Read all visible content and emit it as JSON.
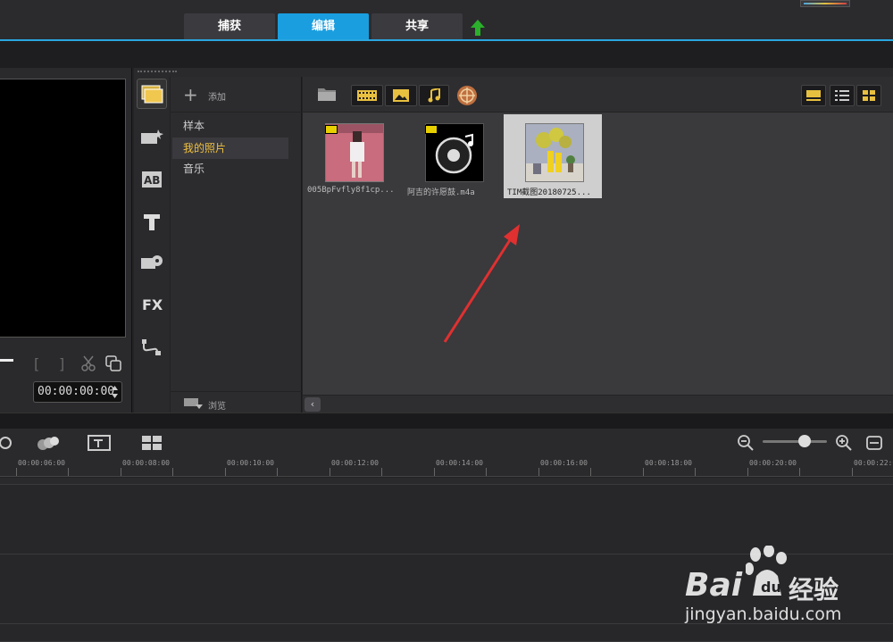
{
  "header": {
    "tabs": [
      {
        "label": "捕获"
      },
      {
        "label": "编辑"
      },
      {
        "label": "共享"
      }
    ],
    "active_tab": "编辑"
  },
  "preview": {
    "timecode": "00:00:00:00"
  },
  "library": {
    "add_label": "添加",
    "folders": [
      {
        "label": "样本"
      },
      {
        "label": "我的照片"
      },
      {
        "label": "音乐"
      }
    ],
    "selected_folder": "我的照片",
    "browse_label": "浏览",
    "items": [
      {
        "label": "005BpFvfly8f1cp...",
        "type": "video"
      },
      {
        "label": "阿吉的许愿鼓.m4a",
        "type": "audio"
      },
      {
        "label": "TIM截图20180725...",
        "type": "photo"
      }
    ]
  },
  "timeline": {
    "ticks": [
      "00:00:06:00",
      "00:00:08:00",
      "00:00:10:00",
      "00:00:12:00",
      "00:00:14:00",
      "00:00:16:00",
      "00:00:18:00",
      "00:00:20:00",
      "00:00:22:00"
    ]
  },
  "watermark": {
    "brand": "Bai",
    "brand_suffix": "经验",
    "url": "jingyan.baidu.com"
  },
  "colors": {
    "accent": "#1a9ee0",
    "selected_folder_text": "#f0c040",
    "arrow": "#e03030"
  }
}
